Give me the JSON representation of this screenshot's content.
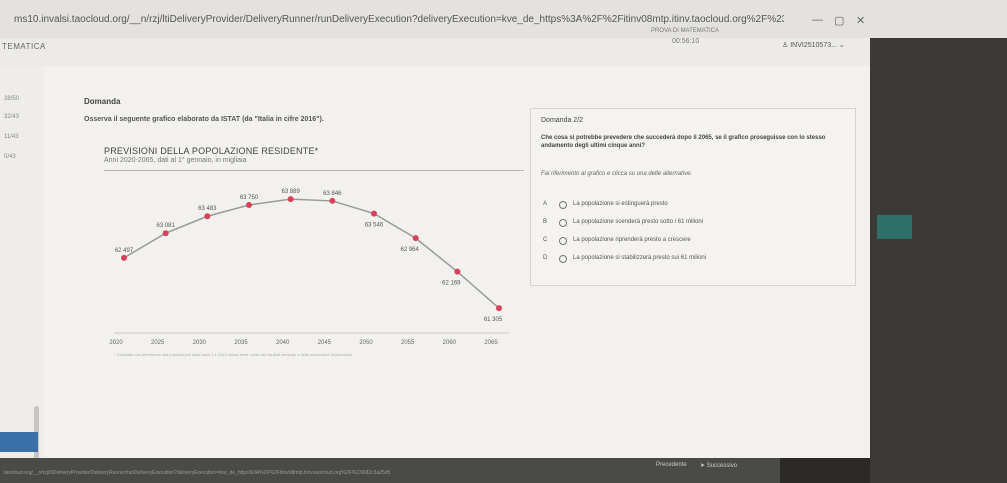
{
  "browser": {
    "url": "ms10.invalsi.taocloud.org/__n/rzj/ltiDeliveryProvider/DeliveryRunner/runDeliveryExecution?deliveryExecution=kve_de_https%3A%2F%2Fitinv08mtp.itinv.taocloud.org%2F%23i682c3a25d5...",
    "star_icon": "star-icon",
    "ext_icon": "extension-icon",
    "profile_icon": "profile-icon",
    "menu_icon": "more-vert-icon",
    "win_min": "—",
    "win_max": "▢",
    "win_close": "✕"
  },
  "header": {
    "brand": "TEMATICA",
    "test_title": "PROVA DI MATEMATICA",
    "timer": "00:56:10",
    "user": "INVI2510573..."
  },
  "nav": {
    "items": [
      "38/50",
      "32/43",
      "11/43",
      "0/43"
    ]
  },
  "question": {
    "label": "Domanda",
    "instruction": "Osserva il seguente grafico elaborato da ISTAT (da \"Italia in cifre 2016\").",
    "number": "Domanda 2/2",
    "text": "Che cosa si potrebbe prevedere che succederà dopo il 2065, se il grafico proseguisse con lo stesso andamento degli ultimi cinque anni?",
    "hint": "Fai riferimento al grafico e clicca su una delle alternative.",
    "options": [
      {
        "letter": "A",
        "text": "La popolazione si estinguerà presto"
      },
      {
        "letter": "B",
        "text": "La popolazione scenderà presto sotto i 61 milioni"
      },
      {
        "letter": "C",
        "text": "La popolazione riprenderà presto a crescere"
      },
      {
        "letter": "D",
        "text": "La popolazione si stabilizzerà presto sui 61 milioni"
      }
    ]
  },
  "chart_data": {
    "type": "line",
    "title": "PREVISIONI DELLA POPOLAZIONE RESIDENTE*",
    "subtitle": "Anni 2020-2065, dati al 1° gennaio, in migliaia",
    "x": [
      "2020",
      "2025",
      "2030",
      "2035",
      "2040",
      "2045",
      "2050",
      "2055",
      "2060",
      "2065"
    ],
    "values": [
      62497,
      63081,
      63483,
      63750,
      63889,
      63846,
      63546,
      62964,
      62169,
      61305
    ],
    "labels": [
      "62 497",
      "63 081",
      "63 483",
      "63 750",
      "63 889",
      "63 846",
      "63 546",
      "62 964",
      "62 169",
      "61 305"
    ],
    "ylim": [
      61000,
      64200
    ],
    "line_color": "#9a9a9a",
    "point_color": "#d9405a",
    "footnote": "* Calcolate con riferimento alla popolazione sulla base 1.1.2015 senza tener conto dei risultati censuari e delle successive ricostruzioni"
  },
  "footer": {
    "status_url": "taocloud.org/__n/rzj/ltiDeliveryProvider/DeliveryRunner/runDeliveryExecution?deliveryExecution=kve_de_https%3A%2F%2Fitinv08mtp.itinv.taocloud.org%2F%23i682c3a25d5",
    "prev": "Precedente",
    "next": "Successivo"
  }
}
